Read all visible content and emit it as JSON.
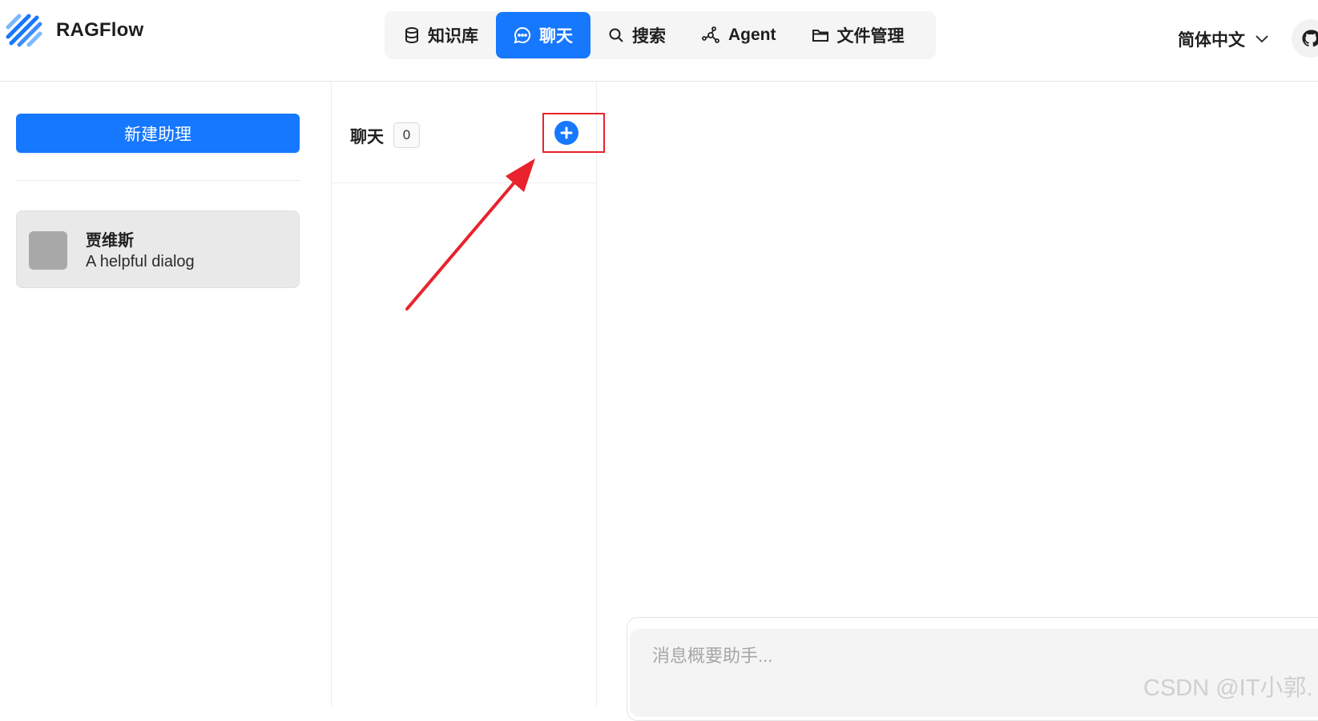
{
  "app": {
    "title": "RAGFlow"
  },
  "nav": {
    "items": [
      {
        "label": "知识库",
        "icon": "database-icon",
        "active": false
      },
      {
        "label": "聊天",
        "icon": "chat-bubble-icon",
        "active": true
      },
      {
        "label": "搜索",
        "icon": "search-icon",
        "active": false
      },
      {
        "label": "Agent",
        "icon": "graph-nodes-icon",
        "active": false
      },
      {
        "label": "文件管理",
        "icon": "folder-icon",
        "active": false
      }
    ]
  },
  "language": {
    "selected": "简体中文"
  },
  "sidebar": {
    "new_assistant_label": "新建助理",
    "assistants": [
      {
        "name": "贾维斯",
        "description": "A helpful dialog"
      }
    ]
  },
  "chat_list": {
    "title": "聊天",
    "count": "0"
  },
  "composer": {
    "placeholder": "消息概要助手..."
  },
  "watermark": "CSDN @IT小郭.",
  "colors": {
    "primary": "#1677ff",
    "annotation": "#e8232d"
  }
}
